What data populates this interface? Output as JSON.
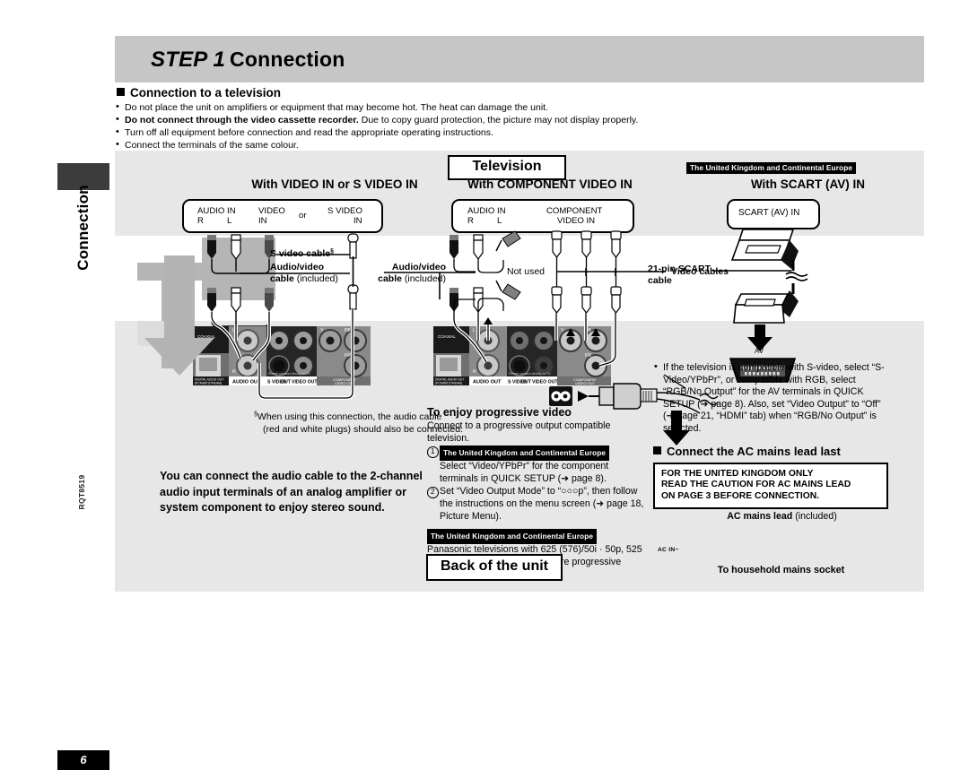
{
  "spine": {
    "section_label": "Connection",
    "doc_code": "RQT8519",
    "page_number": "6"
  },
  "header": {
    "step_prefix": "STEP 1",
    "title": "Connection"
  },
  "intro": {
    "heading": "Connection to a television",
    "bullets": [
      "Do not place the unit on amplifiers or equipment that may become hot. The heat can damage the unit.",
      "Do not connect through the video cassette recorder. Due to copy guard protection, the picture may not display properly.",
      "Turn off all equipment before connection and read the appropriate operating instructions.",
      "Connect the terminals of the same colour."
    ],
    "bullet2_bold": "Do not connect through the video cassette recorder.",
    "bullet2_rest": " Due to copy guard protection, the picture may not display properly."
  },
  "diagram": {
    "television_banner": "Television",
    "back_of_unit_banner": "Back of the unit",
    "region_badge": "The United Kingdom and Continental Europe",
    "columns": [
      {
        "heading": "With VIDEO IN or S VIDEO IN"
      },
      {
        "heading": "With COMPONENT VIDEO IN"
      },
      {
        "heading": "With SCART (AV) IN"
      }
    ],
    "tv_terminals_1": {
      "audio_in": "AUDIO IN",
      "audio_r": "R",
      "audio_l": "L",
      "video_in_1": "VIDEO",
      "video_in_2": "IN",
      "or": "or",
      "s_video_1": "S VIDEO",
      "s_video_2": "IN"
    },
    "tv_terminals_2": {
      "audio_in": "AUDIO IN",
      "audio_r": "R",
      "audio_l": "L",
      "component_1": "COMPONENT",
      "component_2": "VIDEO IN"
    },
    "tv_terminals_3": {
      "scart": "SCART (AV) IN"
    },
    "cable_labels": {
      "s_video_cable": "S video cable",
      "s_video_cable_mark": "§",
      "av_cable_bold": "Audio/video",
      "av_cable_bold2": "cable",
      "av_cable_reg": " (included)",
      "not_used": "Not used",
      "video_cables": "Video cables",
      "scart_cable_1": "21-pin SCART",
      "scart_cable_2": "cable",
      "av_port": "AV"
    },
    "rear_panel": {
      "coaxial": "COAXIAL",
      "optical": "OPTICAL",
      "digital_audio_out": "DIGITAL AUDIO OUT",
      "digital_audio_out2": "(PCM/BITSTREAM)",
      "audio_out": "AUDIO OUT",
      "audio_l": "L",
      "audio_r": "R",
      "s_video_out": "S VIDEO OUT",
      "video_out": "VIDEO OUT",
      "please_connect": "Please connect directly to TV.",
      "component_video_out": "COMPONENT",
      "component_video_out2": "VIDEO OUT",
      "y": "Y",
      "pb": "PB",
      "pr": "PR"
    }
  },
  "footnote": {
    "mark": "§",
    "line1": "When using this connection, the audio cable",
    "line2": "(red and white plugs) should also be connected."
  },
  "left_note": "You can connect the audio cable to the 2-channel audio input terminals of an analog amplifier or system component to enjoy stereo sound.",
  "progressive": {
    "heading": "To enjoy progressive video",
    "intro": "Connect to a progressive output compatible television.",
    "step1_badge": "The United Kingdom and Continental Europe",
    "step1_text": "Select “Video/YPbPr” for the component terminals in QUICK SETUP (➜ page 8).",
    "step2_text": "Set “Video Output Mode” to “○○○p”, then follow the instructions on the menu screen (➜ page 18, Picture Menu).",
    "note_badge": "The United Kingdom and Continental Europe",
    "note_text": "Panasonic televisions with 625 (576)/50i · 50p, 525 (480)/60i . 60p input terminals are progressive compatible."
  },
  "scart_note": "If the television is compatible with S-video, select “S-Video/YPbPr”, or compatible with RGB, select “RGB/No Output” for the AV terminals in QUICK SETUP (➜ page 8). Also, set “Video Output” to “Off” (➜ page 21, “HDMI” tab) when “RGB/No Output” is selected.",
  "ac_section": {
    "heading": "Connect the AC mains lead last",
    "caution_line1": "FOR THE UNITED KINGDOM ONLY",
    "caution_line2": "READ THE CAUTION FOR AC MAINS LEAD",
    "caution_line3": "ON PAGE 3 BEFORE CONNECTION.",
    "lead_label_bold": "AC mains lead",
    "lead_label_reg": " (included)",
    "ac_in": "AC IN~",
    "socket_label": "To household mains socket"
  },
  "colors": {
    "title_band": "#c6c6c6",
    "content_bg": "#e7e7e7",
    "panel_dark": "#555555",
    "badge_bg": "#000000"
  }
}
